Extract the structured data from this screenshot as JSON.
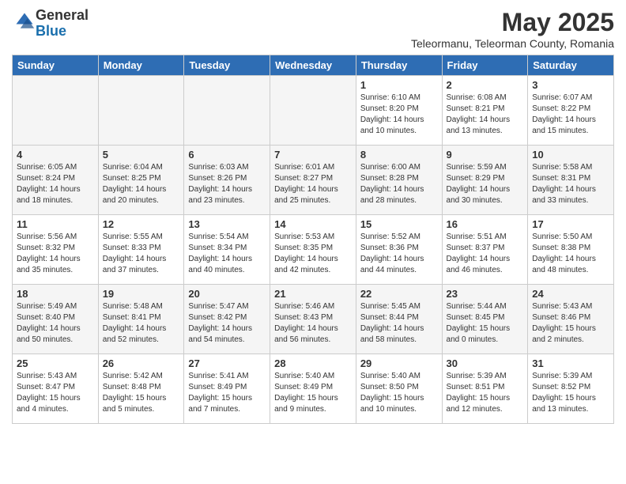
{
  "header": {
    "logo_general": "General",
    "logo_blue": "Blue",
    "month": "May 2025",
    "subtitle": "Teleormanu, Teleorman County, Romania"
  },
  "weekdays": [
    "Sunday",
    "Monday",
    "Tuesday",
    "Wednesday",
    "Thursday",
    "Friday",
    "Saturday"
  ],
  "rows": [
    [
      {
        "day": "",
        "text": "",
        "empty": true
      },
      {
        "day": "",
        "text": "",
        "empty": true
      },
      {
        "day": "",
        "text": "",
        "empty": true
      },
      {
        "day": "",
        "text": "",
        "empty": true
      },
      {
        "day": "1",
        "text": "Sunrise: 6:10 AM\nSunset: 8:20 PM\nDaylight: 14 hours\nand 10 minutes."
      },
      {
        "day": "2",
        "text": "Sunrise: 6:08 AM\nSunset: 8:21 PM\nDaylight: 14 hours\nand 13 minutes."
      },
      {
        "day": "3",
        "text": "Sunrise: 6:07 AM\nSunset: 8:22 PM\nDaylight: 14 hours\nand 15 minutes."
      }
    ],
    [
      {
        "day": "4",
        "text": "Sunrise: 6:05 AM\nSunset: 8:24 PM\nDaylight: 14 hours\nand 18 minutes."
      },
      {
        "day": "5",
        "text": "Sunrise: 6:04 AM\nSunset: 8:25 PM\nDaylight: 14 hours\nand 20 minutes."
      },
      {
        "day": "6",
        "text": "Sunrise: 6:03 AM\nSunset: 8:26 PM\nDaylight: 14 hours\nand 23 minutes."
      },
      {
        "day": "7",
        "text": "Sunrise: 6:01 AM\nSunset: 8:27 PM\nDaylight: 14 hours\nand 25 minutes."
      },
      {
        "day": "8",
        "text": "Sunrise: 6:00 AM\nSunset: 8:28 PM\nDaylight: 14 hours\nand 28 minutes."
      },
      {
        "day": "9",
        "text": "Sunrise: 5:59 AM\nSunset: 8:29 PM\nDaylight: 14 hours\nand 30 minutes."
      },
      {
        "day": "10",
        "text": "Sunrise: 5:58 AM\nSunset: 8:31 PM\nDaylight: 14 hours\nand 33 minutes."
      }
    ],
    [
      {
        "day": "11",
        "text": "Sunrise: 5:56 AM\nSunset: 8:32 PM\nDaylight: 14 hours\nand 35 minutes."
      },
      {
        "day": "12",
        "text": "Sunrise: 5:55 AM\nSunset: 8:33 PM\nDaylight: 14 hours\nand 37 minutes."
      },
      {
        "day": "13",
        "text": "Sunrise: 5:54 AM\nSunset: 8:34 PM\nDaylight: 14 hours\nand 40 minutes."
      },
      {
        "day": "14",
        "text": "Sunrise: 5:53 AM\nSunset: 8:35 PM\nDaylight: 14 hours\nand 42 minutes."
      },
      {
        "day": "15",
        "text": "Sunrise: 5:52 AM\nSunset: 8:36 PM\nDaylight: 14 hours\nand 44 minutes."
      },
      {
        "day": "16",
        "text": "Sunrise: 5:51 AM\nSunset: 8:37 PM\nDaylight: 14 hours\nand 46 minutes."
      },
      {
        "day": "17",
        "text": "Sunrise: 5:50 AM\nSunset: 8:38 PM\nDaylight: 14 hours\nand 48 minutes."
      }
    ],
    [
      {
        "day": "18",
        "text": "Sunrise: 5:49 AM\nSunset: 8:40 PM\nDaylight: 14 hours\nand 50 minutes."
      },
      {
        "day": "19",
        "text": "Sunrise: 5:48 AM\nSunset: 8:41 PM\nDaylight: 14 hours\nand 52 minutes."
      },
      {
        "day": "20",
        "text": "Sunrise: 5:47 AM\nSunset: 8:42 PM\nDaylight: 14 hours\nand 54 minutes."
      },
      {
        "day": "21",
        "text": "Sunrise: 5:46 AM\nSunset: 8:43 PM\nDaylight: 14 hours\nand 56 minutes."
      },
      {
        "day": "22",
        "text": "Sunrise: 5:45 AM\nSunset: 8:44 PM\nDaylight: 14 hours\nand 58 minutes."
      },
      {
        "day": "23",
        "text": "Sunrise: 5:44 AM\nSunset: 8:45 PM\nDaylight: 15 hours\nand 0 minutes."
      },
      {
        "day": "24",
        "text": "Sunrise: 5:43 AM\nSunset: 8:46 PM\nDaylight: 15 hours\nand 2 minutes."
      }
    ],
    [
      {
        "day": "25",
        "text": "Sunrise: 5:43 AM\nSunset: 8:47 PM\nDaylight: 15 hours\nand 4 minutes."
      },
      {
        "day": "26",
        "text": "Sunrise: 5:42 AM\nSunset: 8:48 PM\nDaylight: 15 hours\nand 5 minutes."
      },
      {
        "day": "27",
        "text": "Sunrise: 5:41 AM\nSunset: 8:49 PM\nDaylight: 15 hours\nand 7 minutes."
      },
      {
        "day": "28",
        "text": "Sunrise: 5:40 AM\nSunset: 8:49 PM\nDaylight: 15 hours\nand 9 minutes."
      },
      {
        "day": "29",
        "text": "Sunrise: 5:40 AM\nSunset: 8:50 PM\nDaylight: 15 hours\nand 10 minutes."
      },
      {
        "day": "30",
        "text": "Sunrise: 5:39 AM\nSunset: 8:51 PM\nDaylight: 15 hours\nand 12 minutes."
      },
      {
        "day": "31",
        "text": "Sunrise: 5:39 AM\nSunset: 8:52 PM\nDaylight: 15 hours\nand 13 minutes."
      }
    ]
  ]
}
